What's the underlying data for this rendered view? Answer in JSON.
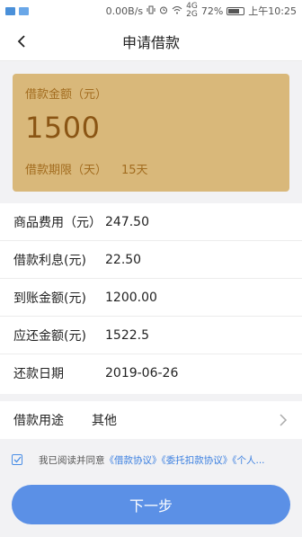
{
  "status_bar": {
    "net_speed": "0.00B/s",
    "battery": "72%",
    "battery_level": 0.72,
    "time": "上午10:25",
    "network_top": "4G",
    "network_bottom": "2G"
  },
  "header": {
    "title": "申请借款"
  },
  "card": {
    "amount_label": "借款金额（元）",
    "amount_value": "1500",
    "term_label": "借款期限（天）",
    "term_value": "15天"
  },
  "details": [
    {
      "label": "商品费用（元）",
      "value": "247.50"
    },
    {
      "label": "借款利息(元)",
      "value": "22.50"
    },
    {
      "label": "到账金额(元)",
      "value": "1200.00"
    },
    {
      "label": "应还金额(元)",
      "value": "1522.5"
    },
    {
      "label": "还款日期",
      "value": "2019-06-26"
    }
  ],
  "purpose": {
    "label": "借款用途",
    "value": "其他"
  },
  "agreement": {
    "prefix": "我已阅读并同意",
    "link1": "《借款协议》",
    "link2": "《委托扣款协议》",
    "link3": "《个人..."
  },
  "next_button": {
    "label": "下一步"
  },
  "colors": {
    "card_bg": "#d9b87a",
    "primary": "#5b90e6",
    "link": "#3a7fe0"
  }
}
